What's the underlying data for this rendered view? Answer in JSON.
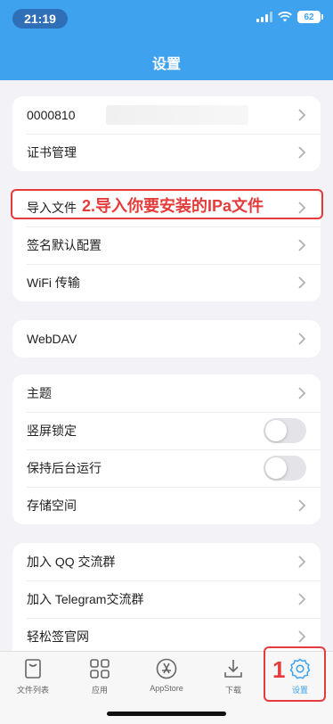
{
  "status": {
    "time": "21:19",
    "battery": "62"
  },
  "page": {
    "title": "设置"
  },
  "groups": [
    {
      "rows": [
        {
          "label": "0000810"
        },
        {
          "label": "证书管理"
        }
      ]
    },
    {
      "rows": [
        {
          "label": "导入文件"
        },
        {
          "label": "签名默认配置"
        },
        {
          "label": "WiFi 传输"
        }
      ]
    },
    {
      "rows": [
        {
          "label": "WebDAV"
        }
      ]
    },
    {
      "rows": [
        {
          "label": "主题"
        },
        {
          "label": "竖屏锁定",
          "toggle": false
        },
        {
          "label": "保持后台运行",
          "toggle": false
        },
        {
          "label": "存储空间"
        }
      ]
    },
    {
      "rows": [
        {
          "label": "加入 QQ 交流群"
        },
        {
          "label": "加入 Telegram交流群"
        },
        {
          "label": "轻松签官网"
        }
      ]
    }
  ],
  "annotations": {
    "import_hint": "2.导入你要安装的IPa文件",
    "settings_step": "1"
  },
  "tabs": [
    {
      "label": "文件列表",
      "icon": "file-list-icon"
    },
    {
      "label": "应用",
      "icon": "apps-grid-icon"
    },
    {
      "label": "AppStore",
      "icon": "appstore-icon"
    },
    {
      "label": "下载",
      "icon": "download-icon"
    },
    {
      "label": "设置",
      "icon": "gear-icon",
      "active": true
    }
  ],
  "colors": {
    "accent": "#3fa2ee",
    "annotation": "#e53b3b"
  }
}
